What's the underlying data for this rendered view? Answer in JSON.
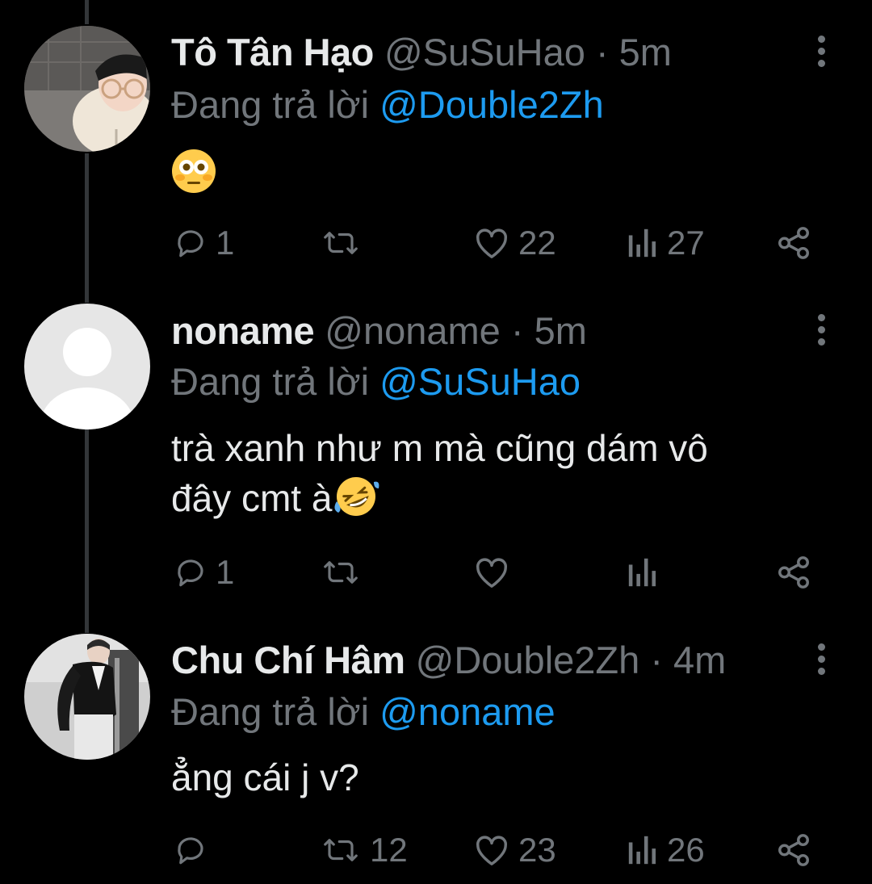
{
  "colors": {
    "background": "#000000",
    "text": "#e7e9ea",
    "secondary": "#71767b",
    "mention": "#1d9bf0",
    "thread_line": "#333639"
  },
  "reply_prefix": "Đang trả lời",
  "tweets": [
    {
      "name": "Tô Tân Hạo",
      "handle": "@SuSuHao",
      "separator": "·",
      "time": "5m",
      "reply_to": "@Double2Zh",
      "text": "",
      "emoji": "flushed-face",
      "replies": "1",
      "retweets": "",
      "likes": "22",
      "views": "27"
    },
    {
      "name": "noname",
      "handle": "@noname",
      "separator": "·",
      "time": "5m",
      "reply_to": "@SuSuHao",
      "text_line1": "trà xanh như m mà cũng dám vô",
      "text_line2": "đây cmt à",
      "emoji": "rolling-laughing-face",
      "replies": "1",
      "retweets": "",
      "likes": "",
      "views": ""
    },
    {
      "name": "Chu Chí Hâm",
      "handle": "@Double2Zh",
      "separator": "·",
      "time": "4m",
      "reply_to": "@noname",
      "text": "ẳng cái j v?",
      "replies": "",
      "retweets": "12",
      "likes": "23",
      "views": "26"
    }
  ]
}
